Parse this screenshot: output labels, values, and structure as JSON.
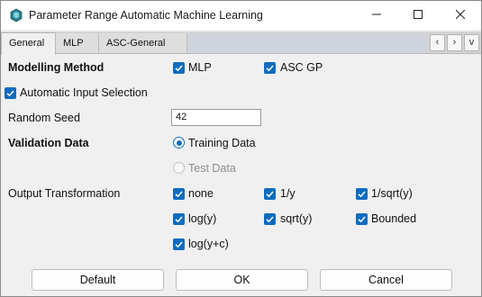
{
  "window": {
    "title": "Parameter Range Automatic Machine Learning",
    "minimize_icon": "minimize-icon",
    "maximize_icon": "maximize-icon",
    "close_icon": "close-icon"
  },
  "tabs": [
    {
      "label": "General",
      "active": true
    },
    {
      "label": "MLP",
      "active": false
    },
    {
      "label": "ASC-General",
      "active": false
    }
  ],
  "tab_nav": {
    "prev": "‹",
    "next": "›",
    "menu": "v"
  },
  "modelling": {
    "label": "Modelling Method",
    "options": [
      {
        "label": "MLP",
        "checked": true
      },
      {
        "label": "ASC GP",
        "checked": true
      }
    ]
  },
  "auto_input": {
    "label": "Automatic Input Selection",
    "checked": true
  },
  "seed": {
    "label": "Random Seed",
    "value": "42"
  },
  "validation": {
    "label": "Validation Data",
    "options": [
      {
        "label": "Training Data",
        "selected": true,
        "enabled": true
      },
      {
        "label": "Test Data",
        "selected": false,
        "enabled": false
      }
    ]
  },
  "output_transform": {
    "label": "Output Transformation",
    "options": [
      {
        "label": "none",
        "checked": true
      },
      {
        "label": "1/y",
        "checked": true
      },
      {
        "label": "1/sqrt(y)",
        "checked": true
      },
      {
        "label": "log(y)",
        "checked": true
      },
      {
        "label": "sqrt(y)",
        "checked": true
      },
      {
        "label": "Bounded",
        "checked": true
      },
      {
        "label": "log(y+c)",
        "checked": true
      }
    ]
  },
  "buttons": {
    "default": "Default",
    "ok": "OK",
    "cancel": "Cancel"
  },
  "colors": {
    "accent": "#0f6cbd"
  }
}
